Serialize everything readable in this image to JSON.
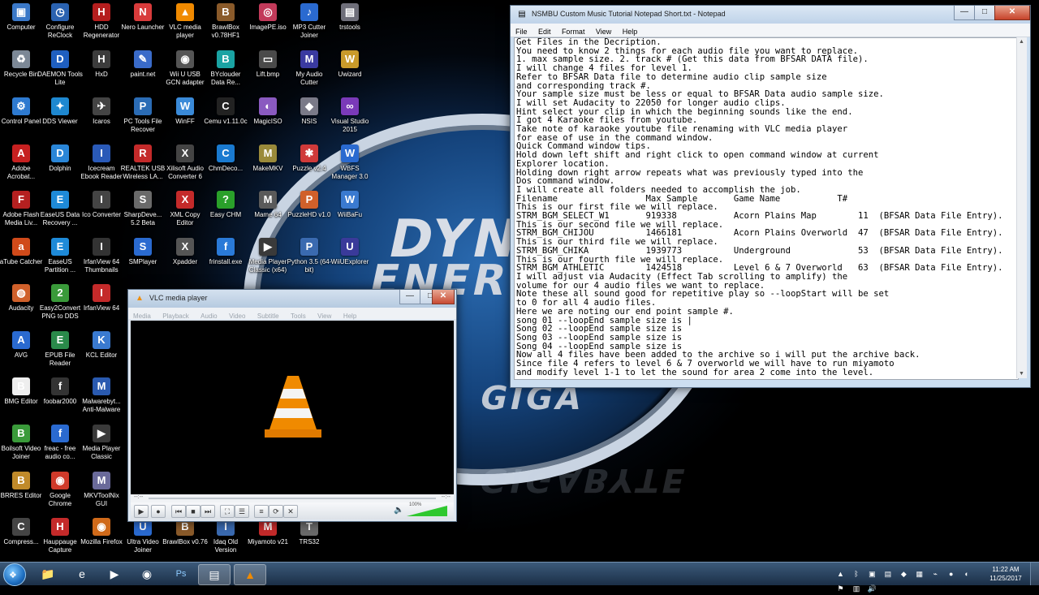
{
  "desktop": {
    "icons": [
      {
        "label": "Computer",
        "col": 0,
        "row": 0,
        "color": "#3a78c8",
        "glyph": "▣",
        "name": "computer-icon"
      },
      {
        "label": "Configure ReClock",
        "col": 1,
        "row": 0,
        "color": "#2a62b0",
        "glyph": "◷",
        "name": "reclock-icon"
      },
      {
        "label": "HDD Regenerator",
        "col": 2,
        "row": 0,
        "color": "#b51e1e",
        "glyph": "H",
        "name": "hdd-regenerator-icon"
      },
      {
        "label": "Nero Launcher",
        "col": 3,
        "row": 0,
        "color": "#d83b3b",
        "glyph": "N",
        "name": "nero-icon"
      },
      {
        "label": "VLC media player",
        "col": 4,
        "row": 0,
        "color": "#f08a00",
        "glyph": "▲",
        "name": "vlc-icon"
      },
      {
        "label": "BrawlBox v0.78HF1",
        "col": 5,
        "row": 0,
        "color": "#8a5a2a",
        "glyph": "B",
        "name": "brawlbox-icon"
      },
      {
        "label": "ImagePE.iso",
        "col": 6,
        "row": 0,
        "color": "#c23a5a",
        "glyph": "◎",
        "name": "imagepe-icon"
      },
      {
        "label": "MP3 Cutter Joiner",
        "col": 7,
        "row": 0,
        "color": "#2a6ad0",
        "glyph": "♪",
        "name": "mp3-cutter-icon"
      },
      {
        "label": "trstools",
        "col": 8,
        "row": 0,
        "color": "#6f6f7a",
        "glyph": "▤",
        "name": "trstools-icon"
      },
      {
        "label": "Recycle Bin",
        "col": 0,
        "row": 1,
        "color": "#7c8896",
        "glyph": "♻",
        "name": "recycle-bin-icon"
      },
      {
        "label": "DAEMON Tools Lite",
        "col": 1,
        "row": 1,
        "color": "#1f5fc0",
        "glyph": "D",
        "name": "daemon-tools-icon"
      },
      {
        "label": "HxD",
        "col": 2,
        "row": 1,
        "color": "#3c3c3c",
        "glyph": "H",
        "name": "hxd-icon"
      },
      {
        "label": "paint.net",
        "col": 3,
        "row": 1,
        "color": "#3a6bc9",
        "glyph": "✎",
        "name": "paintnet-icon"
      },
      {
        "label": "Wii U USB GCN adapter",
        "col": 4,
        "row": 1,
        "color": "#555",
        "glyph": "◉",
        "name": "wiiu-usb-icon"
      },
      {
        "label": "BYclouder Data Re...",
        "col": 5,
        "row": 1,
        "color": "#1aa3a3",
        "glyph": "B",
        "name": "byclouder-icon"
      },
      {
        "label": "Lift.bmp",
        "col": 6,
        "row": 1,
        "color": "#4a4a4a",
        "glyph": "▭",
        "name": "lift-bmp-icon"
      },
      {
        "label": "My Audio Cutter",
        "col": 7,
        "row": 1,
        "color": "#3a3aa0",
        "glyph": "M",
        "name": "audio-cutter-icon"
      },
      {
        "label": "Uwizard",
        "col": 8,
        "row": 1,
        "color": "#c99a2a",
        "glyph": "W",
        "name": "uwizard-icon"
      },
      {
        "label": "Control Panel",
        "col": 0,
        "row": 2,
        "color": "#2e7ad0",
        "glyph": "⚙",
        "name": "control-panel-icon"
      },
      {
        "label": "DDS Viewer",
        "col": 1,
        "row": 2,
        "color": "#1e88d0",
        "glyph": "✦",
        "name": "dds-viewer-icon"
      },
      {
        "label": "Icaros",
        "col": 2,
        "row": 2,
        "color": "#444",
        "glyph": "✈",
        "name": "icaros-icon"
      },
      {
        "label": "PC Tools File Recover",
        "col": 3,
        "row": 2,
        "color": "#2b6cb5",
        "glyph": "P",
        "name": "pc-tools-icon"
      },
      {
        "label": "WinFF",
        "col": 4,
        "row": 2,
        "color": "#3a8ad8",
        "glyph": "W",
        "name": "winff-icon"
      },
      {
        "label": "Cemu v1.11.0c",
        "col": 5,
        "row": 2,
        "color": "#222",
        "glyph": "C",
        "name": "cemu-icon"
      },
      {
        "label": "MagicISO",
        "col": 6,
        "row": 2,
        "color": "#8a5ac0",
        "glyph": "◐",
        "name": "magiciso-icon"
      },
      {
        "label": "NSIS",
        "col": 7,
        "row": 2,
        "color": "#7a7a88",
        "glyph": "◆",
        "name": "nsis-icon"
      },
      {
        "label": "Visual Studio 2015",
        "col": 8,
        "row": 2,
        "color": "#7a3ab8",
        "glyph": "∞",
        "name": "visual-studio-icon"
      },
      {
        "label": "Adobe Acrobat...",
        "col": 0,
        "row": 3,
        "color": "#c62020",
        "glyph": "A",
        "name": "acrobat-icon"
      },
      {
        "label": "Dolphin",
        "col": 1,
        "row": 3,
        "color": "#2a86d8",
        "glyph": "D",
        "name": "dolphin-icon"
      },
      {
        "label": "Icecream Ebook Reader",
        "col": 2,
        "row": 3,
        "color": "#2a5ab8",
        "glyph": "I",
        "name": "icecream-icon"
      },
      {
        "label": "REALTEK USB Wireless LA...",
        "col": 3,
        "row": 3,
        "color": "#c42a2a",
        "glyph": "R",
        "name": "realtek-icon"
      },
      {
        "label": "Xilisoft Audio Converter 6",
        "col": 4,
        "row": 3,
        "color": "#444",
        "glyph": "X",
        "name": "xilisoft-icon"
      },
      {
        "label": "ChmDeco...",
        "col": 5,
        "row": 3,
        "color": "#1a7ad0",
        "glyph": "C",
        "name": "chmdeco-icon"
      },
      {
        "label": "MakeMKV",
        "col": 6,
        "row": 3,
        "color": "#9a8a3a",
        "glyph": "M",
        "name": "makemkv-icon"
      },
      {
        "label": "Puzzle v2.4",
        "col": 7,
        "row": 3,
        "color": "#d03a3a",
        "glyph": "✱",
        "name": "puzzle-icon"
      },
      {
        "label": "WBFS Manager 3.0",
        "col": 8,
        "row": 3,
        "color": "#2a6ad0",
        "glyph": "W",
        "name": "wbfs-icon"
      },
      {
        "label": "Adobe Flash Media Liv...",
        "col": 0,
        "row": 4,
        "color": "#b52020",
        "glyph": "F",
        "name": "flash-media-icon"
      },
      {
        "label": "EaseUS Data Recovery ...",
        "col": 1,
        "row": 4,
        "color": "#1e8ad8",
        "glyph": "E",
        "name": "easeus-recovery-icon"
      },
      {
        "label": "Ico Converter",
        "col": 2,
        "row": 4,
        "color": "#444",
        "glyph": "I",
        "name": "ico-converter-icon"
      },
      {
        "label": "SharpDeve... 5.2 Beta",
        "col": 3,
        "row": 4,
        "color": "#6a6a6a",
        "glyph": "S",
        "name": "sharpdevelop-icon"
      },
      {
        "label": "XML Copy Editor",
        "col": 4,
        "row": 4,
        "color": "#c42a2a",
        "glyph": "X",
        "name": "xml-copy-icon"
      },
      {
        "label": "Easy CHM",
        "col": 5,
        "row": 4,
        "color": "#2aa02a",
        "glyph": "?",
        "name": "easy-chm-icon"
      },
      {
        "label": "Mame 64",
        "col": 6,
        "row": 4,
        "color": "#5a5a5a",
        "glyph": "M",
        "name": "mame-icon"
      },
      {
        "label": "PuzzleHD v1.0",
        "col": 7,
        "row": 4,
        "color": "#d0602a",
        "glyph": "P",
        "name": "puzzlehd-icon"
      },
      {
        "label": "WiiBaFu",
        "col": 8,
        "row": 4,
        "color": "#3a7ad0",
        "glyph": "W",
        "name": "wiibafu-icon"
      },
      {
        "label": "aTube Catcher",
        "col": 0,
        "row": 5,
        "color": "#d04a1a",
        "glyph": "a",
        "name": "atube-icon"
      },
      {
        "label": "EaseUS Partition ...",
        "col": 1,
        "row": 5,
        "color": "#1e8ad8",
        "glyph": "E",
        "name": "easeus-partition-icon"
      },
      {
        "label": "IrfanView 64 Thumbnails",
        "col": 2,
        "row": 5,
        "color": "#333",
        "glyph": "I",
        "name": "irfanview-thumbs-icon"
      },
      {
        "label": "SMPlayer",
        "col": 3,
        "row": 5,
        "color": "#2a6ad0",
        "glyph": "S",
        "name": "smplayer-icon"
      },
      {
        "label": "Xpadder",
        "col": 4,
        "row": 5,
        "color": "#555",
        "glyph": "X",
        "name": "xpadder-icon"
      },
      {
        "label": "frinstall.exe",
        "col": 5,
        "row": 5,
        "color": "#2a7ad8",
        "glyph": "f",
        "name": "frinstall-icon"
      },
      {
        "label": "Media Player Classic (x64)",
        "col": 6,
        "row": 5,
        "color": "#3a3a3a",
        "glyph": "▶",
        "name": "mpc-x64-icon"
      },
      {
        "label": "Python 3.5 (64-bit)",
        "col": 7,
        "row": 5,
        "color": "#3a6ab0",
        "glyph": "P",
        "name": "python-icon"
      },
      {
        "label": "WiiUExplorer",
        "col": 8,
        "row": 5,
        "color": "#3a3a9a",
        "glyph": "U",
        "name": "wiiuexplorer-icon"
      },
      {
        "label": "Audacity",
        "col": 0,
        "row": 6,
        "color": "#d0602a",
        "glyph": "◍",
        "name": "audacity-icon"
      },
      {
        "label": "Easy2Convert PNG to DDS",
        "col": 1,
        "row": 6,
        "color": "#3a9a3a",
        "glyph": "2",
        "name": "easy2convert-icon"
      },
      {
        "label": "IrfanView 64",
        "col": 2,
        "row": 6,
        "color": "#c42a2a",
        "glyph": "I",
        "name": "irfanview-icon"
      },
      {
        "label": "AVG",
        "col": 0,
        "row": 7,
        "color": "#2a6ad0",
        "glyph": "A",
        "name": "avg-icon"
      },
      {
        "label": "EPUB File Reader",
        "col": 1,
        "row": 7,
        "color": "#2a8a4a",
        "glyph": "E",
        "name": "epub-reader-icon"
      },
      {
        "label": "KCL Editor",
        "col": 2,
        "row": 7,
        "color": "#3a7ad0",
        "glyph": "K",
        "name": "kcl-editor-icon"
      },
      {
        "label": "BMG Editor",
        "col": 0,
        "row": 8,
        "color": "#eee",
        "glyph": "B",
        "name": "bmg-editor-icon"
      },
      {
        "label": "foobar2000",
        "col": 1,
        "row": 8,
        "color": "#333",
        "glyph": "f",
        "name": "foobar-icon"
      },
      {
        "label": "Malwarebyt... Anti-Malware",
        "col": 2,
        "row": 8,
        "color": "#2a5ab0",
        "glyph": "M",
        "name": "malwarebytes-icon"
      },
      {
        "label": "Boilsoft Video Joiner",
        "col": 0,
        "row": 9,
        "color": "#3a9a3a",
        "glyph": "B",
        "name": "boilsoft-icon"
      },
      {
        "label": "freac - free audio co...",
        "col": 1,
        "row": 9,
        "color": "#2a6ad0",
        "glyph": "f",
        "name": "freac-icon"
      },
      {
        "label": "Media Player Classic",
        "col": 2,
        "row": 9,
        "color": "#3a3a3a",
        "glyph": "▶",
        "name": "mpc-icon"
      },
      {
        "label": "BRRES Editor",
        "col": 0,
        "row": 10,
        "color": "#c08a2a",
        "glyph": "B",
        "name": "brres-editor-icon"
      },
      {
        "label": "Google Chrome",
        "col": 1,
        "row": 10,
        "color": "#d03a2a",
        "glyph": "◉",
        "name": "chrome-desktop-icon"
      },
      {
        "label": "MKVToolNix GUI",
        "col": 2,
        "row": 10,
        "color": "#6a6a9a",
        "glyph": "M",
        "name": "mkvtoolnix-icon"
      },
      {
        "label": "Compress...",
        "col": 0,
        "row": 11,
        "color": "#444",
        "glyph": "C",
        "name": "compress-icon"
      },
      {
        "label": "Hauppauge Capture",
        "col": 1,
        "row": 11,
        "color": "#c42a2a",
        "glyph": "H",
        "name": "hauppauge-icon"
      },
      {
        "label": "Mozilla Firefox",
        "col": 2,
        "row": 11,
        "color": "#d06a1a",
        "glyph": "◉",
        "name": "firefox-icon"
      },
      {
        "label": "Ultra Video Joiner",
        "col": 3,
        "row": 11,
        "color": "#2a6ad0",
        "glyph": "U",
        "name": "ultra-video-icon"
      },
      {
        "label": "BrawlBox v0.76",
        "col": 4,
        "row": 11,
        "color": "#8a5a2a",
        "glyph": "B",
        "name": "brawlbox-076-icon"
      },
      {
        "label": "Idaq Old Version",
        "col": 5,
        "row": 11,
        "color": "#3a6ab0",
        "glyph": "I",
        "name": "idaq-icon"
      },
      {
        "label": "Miyamoto v21",
        "col": 6,
        "row": 11,
        "color": "#c42a2a",
        "glyph": "M",
        "name": "miyamoto-icon"
      },
      {
        "label": "TRS32",
        "col": 7,
        "row": 11,
        "color": "#6a6a6a",
        "glyph": "T",
        "name": "trs32-icon"
      }
    ]
  },
  "wallpaper": {
    "word1": "DYN",
    "word2": "ENERGY",
    "word3": "GIGA",
    "word4": "GIGABYTE"
  },
  "notepad": {
    "title": "NSMBU Custom Music Tutorial Notepad Short.txt - Notepad",
    "menu": [
      "File",
      "Edit",
      "Format",
      "View",
      "Help"
    ],
    "lines": [
      "Get Files in the Decription.",
      "You need to know 2 things for each audio file you want to replace.",
      "1. max sample size. 2. track # (Get this data from BFSAR DATA file).",
      "I will change 4 files for level 1.",
      "Refer to BFSAR Data file to determine audio clip sample size",
      "and corresponding track #.",
      "Your sample size must be less or equal to BFSAR Data audio sample size.",
      "I will set Audacity to 22050 for longer audio clips.",
      "Hint select your clip in which the beginning sounds like the end.",
      "I got 4 Karaoke files from youtube.",
      "Take note of karaoke youtube file renaming with VLC media player",
      "for ease of use in the command window.",
      "Quick Command window tips.",
      "Hold down left shift and right click to open command window at current",
      "Explorer location.",
      "Holding down right arrow repeats what was previously typed into the",
      "Dos command window.",
      "I will create all folders needed to accomplish the job.",
      "Filename                 Max Sample       Game Name           T#",
      "This is our first file we will replace.",
      "STRM_BGM_SELECT_W1       919338           Acorn Plains Map        11  (BFSAR Data File Entry).",
      "This is our second file we will replace.",
      "STRM_BGM_CHIJOU          1466181          Acorn Plains Overworld  47  (BFSAR Data File Entry).",
      "This is our third file we will replace.",
      "STRM_BGM_CHIKA           1939773          Underground             53  (BFSAR Data File Entry).",
      "This is our fourth file we will replace.",
      "STRM_BGM_ATHLETIC        1424518          Level 6 & 7 Overworld   63  (BFSAR Data File Entry).",
      "I will adjust via Audacity (Effect Tab scrolling to amplify) the",
      "volume for our 4 audio files we want to replace.",
      "Note these all sound good for repetitive play so --loopStart will be set",
      "to 0 for all 4 audio files.",
      "Here we are noting our end point sample #.",
      "song 01 --loopEnd sample size is |",
      "Song 02 --loopEnd sample size is",
      "Song 03 --loopEnd sample size is",
      "Song 04 --loopEnd sample size is",
      "Now all 4 files have been added to the archive so i will put the archive back.",
      "Since file 4 refers to level 6 & 7 overworld we will have to run miyamoto",
      "and modify level 1-1 to let the sound for area 2 come into the level."
    ]
  },
  "vlc": {
    "title": "VLC media player",
    "menu": [
      "Media",
      "Playback",
      "Audio",
      "Video",
      "Subtitle",
      "Tools",
      "View",
      "Help"
    ],
    "time_elapsed": "--:--",
    "time_total": "--:--",
    "volume_label": "100%",
    "volume_level": 1.0
  },
  "taskbar": {
    "clock_time": "11:22 AM",
    "clock_date": "11/25/2017",
    "pinned": [
      {
        "name": "explorer-taskbar-icon",
        "glyph": "📁"
      },
      {
        "name": "ie-taskbar-icon",
        "glyph": "e"
      },
      {
        "name": "media-taskbar-icon",
        "glyph": "▶"
      },
      {
        "name": "chrome-taskbar-icon",
        "glyph": "◉"
      },
      {
        "name": "photoshop-taskbar-icon",
        "glyph": "Ps"
      },
      {
        "name": "notepad-taskbar-icon",
        "glyph": "▤"
      },
      {
        "name": "vlc-taskbar-icon",
        "glyph": "▲"
      }
    ]
  },
  "colors": {
    "vlc_orange": "#f08a00",
    "volume_green": "#2fc82f",
    "close_red": "#c7432a"
  }
}
